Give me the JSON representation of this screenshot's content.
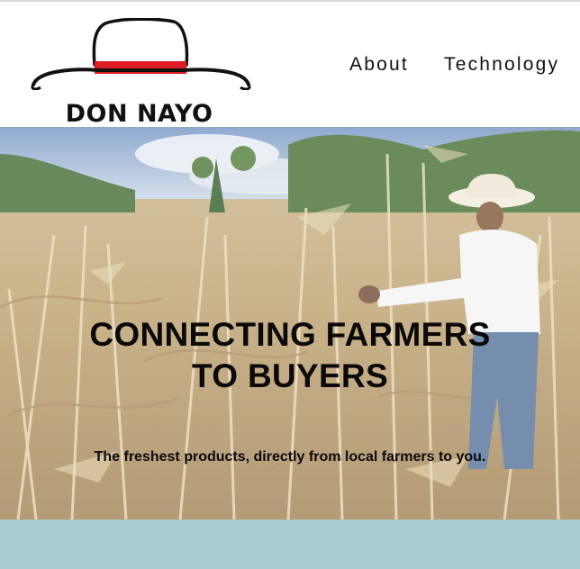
{
  "brand": {
    "name": "DON NAYO",
    "logo_icon": "hat-logo-icon",
    "hat_band_color": "#e01b24"
  },
  "nav": {
    "items": [
      {
        "label": "About"
      },
      {
        "label": "Technology"
      }
    ]
  },
  "hero": {
    "title_line1": "CONNECTING FARMERS",
    "title_line2": "TO BUYERS",
    "subtitle": "The freshest products, directly from local farmers to you."
  },
  "colors": {
    "band": "#a9ccce",
    "text": "#0a0a0a"
  }
}
